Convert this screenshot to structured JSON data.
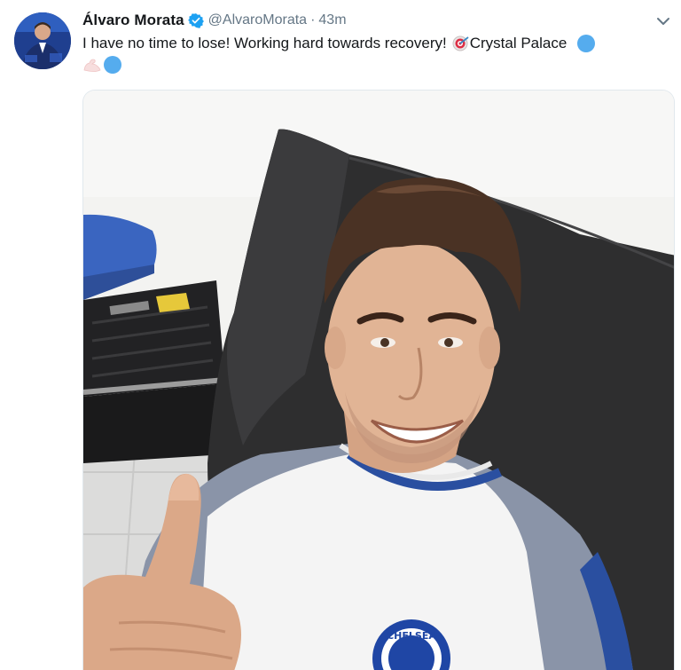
{
  "tweet": {
    "author_name": "Álvaro Morata",
    "handle": "@AlvaroMorata",
    "separator": "·",
    "time": "43m",
    "text": "I have no time to lose! Working hard towards recovery!",
    "place": "Crystal Palace",
    "verified": true
  },
  "media": {
    "alt_shirt_text": "CHELSEA"
  },
  "icons": {
    "verified": "verified-badge-icon",
    "caret": "chevron-down-icon",
    "pin": "target-pin-emoji",
    "circle": "blue-circle-emoji",
    "muscle": "flexed-biceps-emoji"
  },
  "colors": {
    "text": "#14171a",
    "secondary": "#657786",
    "verified": "#1da1f2",
    "emoji_blue": "#55acee"
  }
}
